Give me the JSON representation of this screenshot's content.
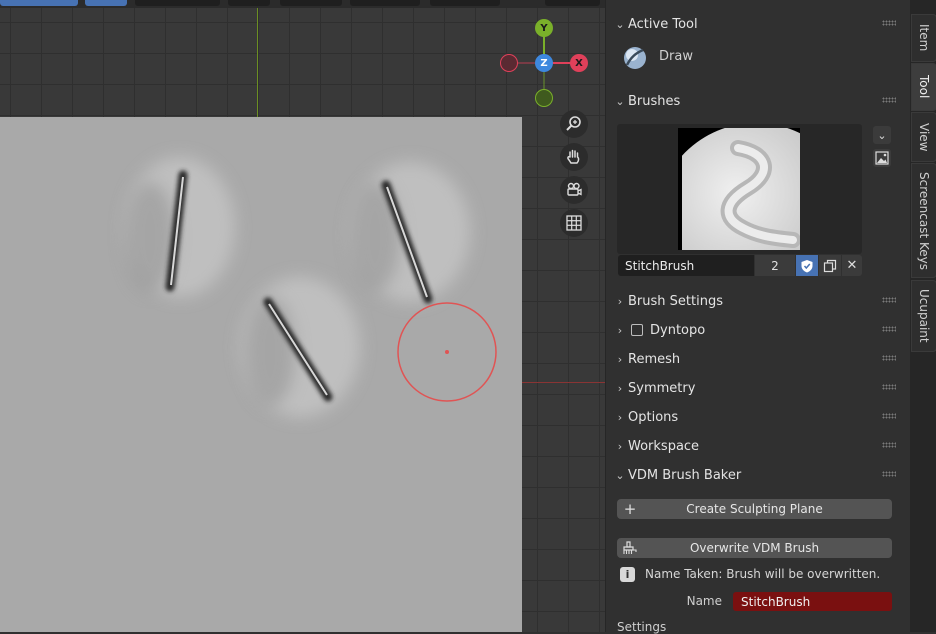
{
  "gizmo": {
    "y": "Y",
    "z": "Z",
    "x": "X"
  },
  "active_tool": {
    "header": "Active Tool",
    "tool_name": "Draw"
  },
  "brushes": {
    "header": "Brushes",
    "brush_name": "StitchBrush",
    "users": "2"
  },
  "sections": [
    {
      "label": "Brush Settings"
    },
    {
      "label": "Dyntopo"
    },
    {
      "label": "Remesh"
    },
    {
      "label": "Symmetry"
    },
    {
      "label": "Options"
    },
    {
      "label": "Workspace"
    }
  ],
  "vdm": {
    "header": "VDM Brush Baker",
    "create_plane_label": "Create Sculpting Plane",
    "overwrite_label": "Overwrite VDM Brush",
    "info_text": "Name Taken: Brush will be overwritten.",
    "name_label": "Name",
    "name_value": "StitchBrush",
    "settings_label": "Settings"
  },
  "tabs": [
    "Item",
    "Tool",
    "View",
    "Screencast Keys",
    "Ucupaint"
  ],
  "colors": {
    "accent": "#4772b3",
    "name_field": "#7a1010",
    "cursor": "#e05454"
  }
}
